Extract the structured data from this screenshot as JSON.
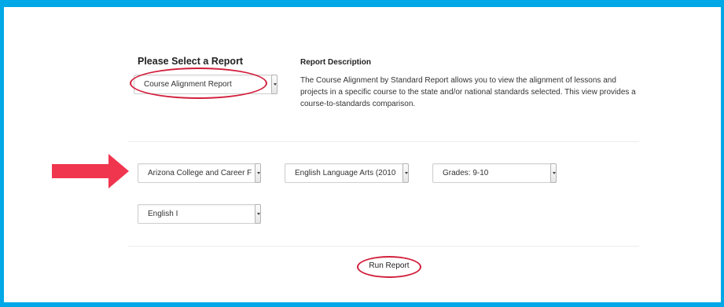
{
  "report_section": {
    "heading": "Please Select a Report",
    "selected_report": "Course Alignment Report"
  },
  "description": {
    "heading": "Report Description",
    "lines": [
      "The Course Alignment by Standard Report allows you to view the alignment of lessons and",
      "projects in a specific course to the state and/or national standards selected. This view provides a",
      "course-to-standards comparison."
    ]
  },
  "filters": {
    "standard_set": "Arizona College and Career F",
    "subject": "English Language Arts (2010",
    "grades": "Grades: 9-10",
    "course": "English I"
  },
  "run_button_label": "Run Report",
  "colors": {
    "frame_border": "#00a8e8",
    "highlight": "#d21f3c",
    "arrow": "#f0364f"
  },
  "icons": {
    "pointer_arrow": "arrow-right-icon",
    "dropdown": "chevron-down-icon"
  }
}
